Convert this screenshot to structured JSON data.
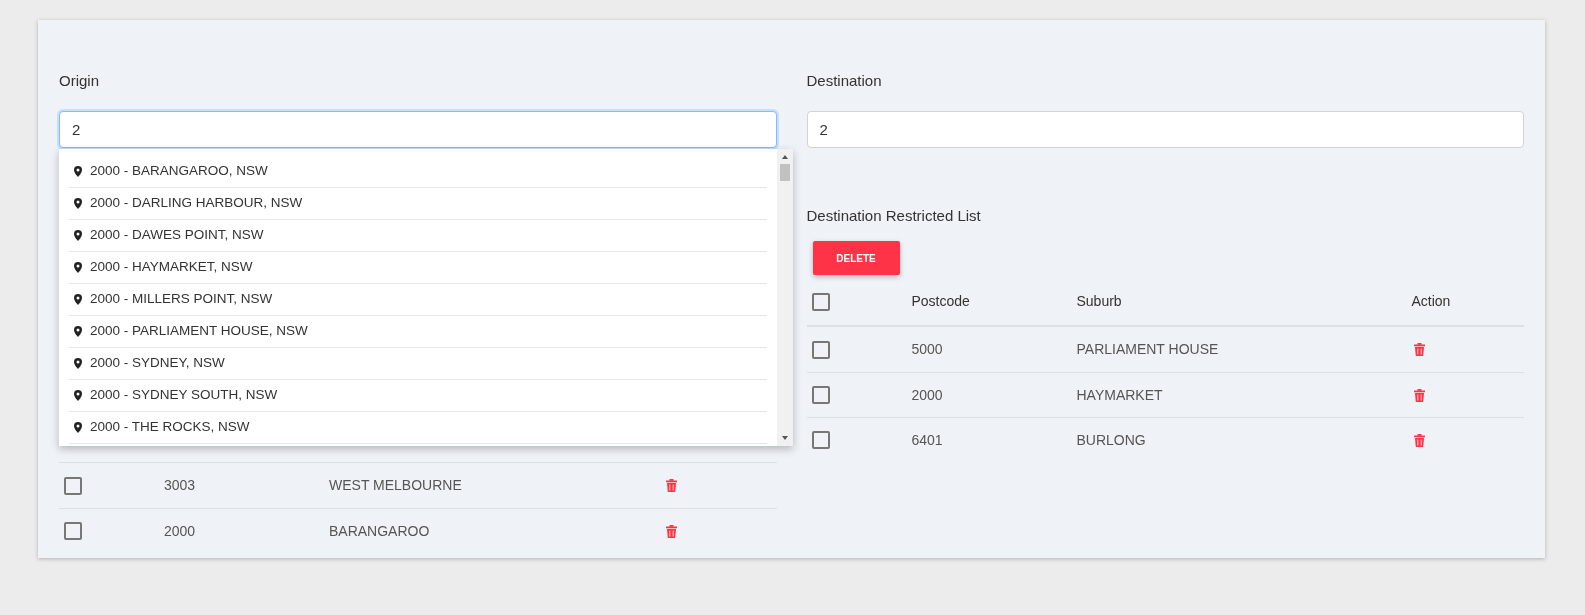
{
  "origin": {
    "label": "Origin",
    "value": "2",
    "focused": true,
    "suggestions": [
      "2000 - BARANGAROO, NSW",
      "2000 - DARLING HARBOUR, NSW",
      "2000 - DAWES POINT, NSW",
      "2000 - HAYMARKET, NSW",
      "2000 - MILLERS POINT, NSW",
      "2000 - PARLIAMENT HOUSE, NSW",
      "2000 - SYDNEY, NSW",
      "2000 - SYDNEY SOUTH, NSW",
      "2000 - THE ROCKS, NSW"
    ]
  },
  "origin_list": {
    "rows": [
      {
        "postcode": "3003",
        "suburb": "WEST MELBOURNE",
        "checked": false
      },
      {
        "postcode": "2000",
        "suburb": "BARANGAROO",
        "checked": false
      }
    ]
  },
  "destination": {
    "label": "Destination",
    "value": "2",
    "focused": false
  },
  "destination_list": {
    "title": "Destination Restricted List",
    "delete_button": "DELETE",
    "columns": [
      "Postcode",
      "Suburb",
      "Action"
    ],
    "header_checked": false,
    "rows": [
      {
        "postcode": "5000",
        "suburb": "PARLIAMENT HOUSE",
        "checked": false
      },
      {
        "postcode": "2000",
        "suburb": "HAYMARKET",
        "checked": false
      },
      {
        "postcode": "6401",
        "suburb": "BURLONG",
        "checked": false
      }
    ]
  }
}
